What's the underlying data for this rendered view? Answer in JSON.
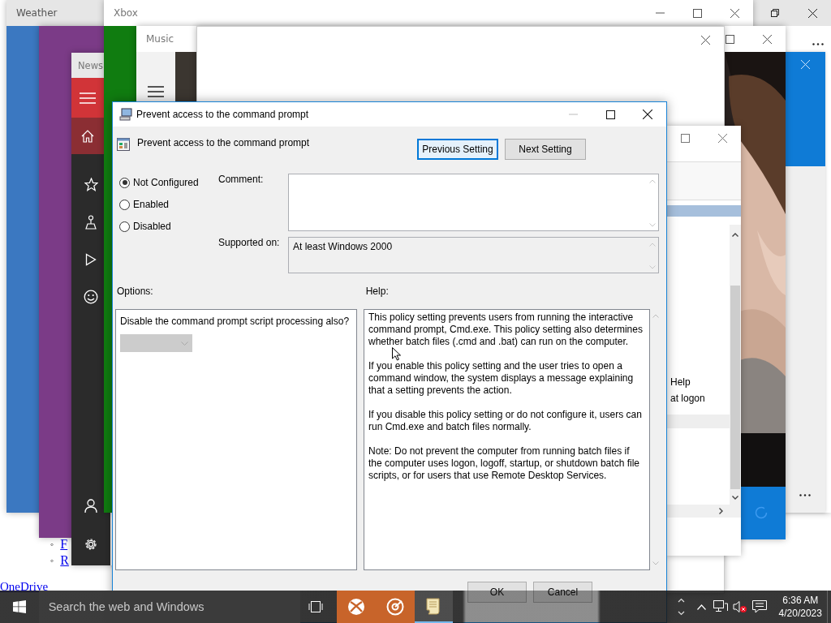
{
  "desktop_page": {
    "list_items": [
      {
        "marker": "◦",
        "text": "F"
      },
      {
        "marker": "◦",
        "text": "R"
      }
    ],
    "link": "OneDrive"
  },
  "windows": [
    {
      "kind": "weather",
      "title": "Weather"
    },
    {
      "kind": "purple"
    },
    {
      "kind": "news",
      "title": "News"
    },
    {
      "kind": "xbox",
      "title": "Xbox"
    },
    {
      "kind": "music",
      "title": "Music"
    },
    {
      "kind": "blank"
    },
    {
      "kind": "policy_list",
      "items": [
        "Help",
        "at logon"
      ]
    }
  ],
  "dialog": {
    "title": "Prevent access to the command prompt",
    "setting_name": "Prevent access to the command prompt",
    "nav_buttons": [
      {
        "label": "Previous Setting",
        "focused": true
      },
      {
        "label": "Next Setting",
        "focused": false
      }
    ],
    "states": [
      {
        "label": "Not Configured",
        "selected": true
      },
      {
        "label": "Enabled",
        "selected": false
      },
      {
        "label": "Disabled",
        "selected": false
      }
    ],
    "comment": {
      "label": "Comment:"
    },
    "supported_on": {
      "label": "Supported on:",
      "value": "At least Windows 2000"
    },
    "options_label": "Options:",
    "help_label": "Help:",
    "option_text": "Disable the command prompt script processing also?",
    "option_dropdown": {
      "disabled": true
    },
    "help_paragraphs": [
      "This policy setting prevents users from running the interactive command prompt, Cmd.exe.  This policy setting also determines whether batch files (.cmd and .bat) can run on the computer.",
      "If you enable this policy setting and the user tries to open a command window, the system displays a message explaining that a setting prevents the action.",
      "If you disable this policy setting or do not configure it, users can run Cmd.exe and batch files normally.",
      "Note: Do not prevent the computer from running batch files if the computer uses logon, logoff, startup, or shutdown batch file scripts, or for users that use Remote Desktop Services."
    ],
    "buttons": [
      "OK",
      "Cancel"
    ]
  },
  "taskbar": {
    "search_placeholder": "Search the web and Windows",
    "apps": [
      {
        "kind": "xbox",
        "highlighted": true,
        "open": false
      },
      {
        "kind": "groove",
        "highlighted": true,
        "open": false
      },
      {
        "kind": "notes",
        "highlighted": false,
        "open": true
      }
    ],
    "time": "6:36 AM",
    "date": "4/20/2023"
  }
}
